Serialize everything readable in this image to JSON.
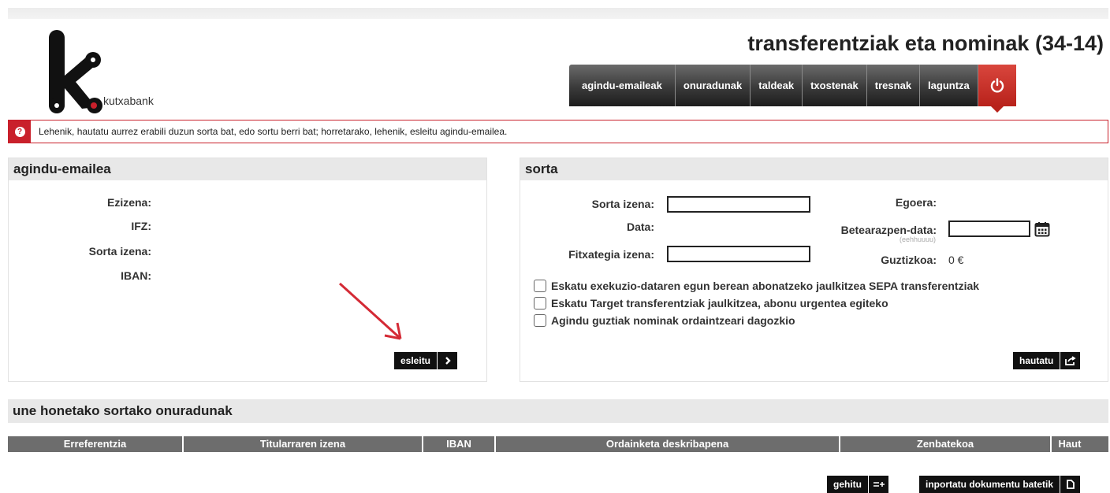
{
  "brand": {
    "name": "kutxabank"
  },
  "page_title": "transferentziak eta nominak (34-14)",
  "nav": {
    "items": [
      "agindu-emaileak",
      "onuradunak",
      "taldeak",
      "txostenak",
      "tresnak",
      "laguntza"
    ],
    "power_icon": "power-icon"
  },
  "alert": {
    "icon": "question-icon",
    "text": "Lehenik, hautatu aurrez erabili duzun sorta bat, edo sortu berri bat; horretarako, lehenik, esleitu agindu-emailea."
  },
  "ordering_party": {
    "title": "agindu-emailea",
    "labels": {
      "name": "Ezizena:",
      "ifz": "IFZ:",
      "batch_name": "Sorta izena:",
      "iban": "IBAN:"
    },
    "assign_button": "esleitu"
  },
  "batch": {
    "title": "sorta",
    "batch_name_label": "Sorta izena:",
    "date_label": "Data:",
    "file_name_label": "Fitxategia izena:",
    "status_label": "Egoera:",
    "execution_date_label": "Betearazpen-data:",
    "execution_date_hint": "(eehhuuuu)",
    "total_label": "Guztizkoa:",
    "total_value": "0 €",
    "options": [
      "Eskatu exekuzio-dataren egun berean abonatzeko jaulkitzea SEPA transferentziak",
      "Eskatu Target transferentziak jaulkitzea, abonu urgentea egiteko",
      "Agindu guztiak nominak ordaintzeari dagozkio"
    ],
    "select_button": "hautatu"
  },
  "beneficiaries": {
    "title": "une honetako sortako onuradunak",
    "columns": [
      "Erreferentzia",
      "Titularraren izena",
      "IBAN",
      "Ordainketa deskribapena",
      "Zenbatekoa",
      "Haut"
    ]
  },
  "actions": {
    "add_button": "gehitu",
    "import_button": "inportatu dokumentu batetik"
  },
  "colors": {
    "accent_red": "#c9202b",
    "nav_dark": "#2a2a2a",
    "header_grey": "#e8e8e8"
  }
}
